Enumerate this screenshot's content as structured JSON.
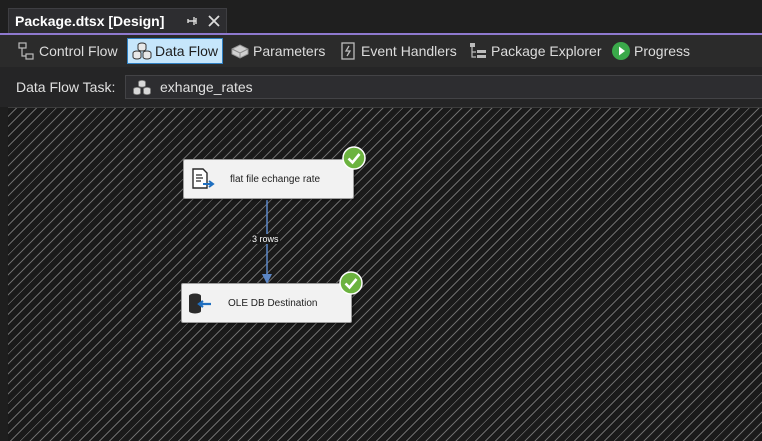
{
  "document_tab": {
    "title": "Package.dtsx [Design]",
    "pin_icon": "pin-icon",
    "close_icon": "close-icon"
  },
  "designer_tabs": [
    {
      "label": "Control Flow",
      "icon": "control-flow-icon",
      "active": false
    },
    {
      "label": "Data Flow",
      "icon": "data-flow-icon",
      "active": true
    },
    {
      "label": "Parameters",
      "icon": "parameters-icon",
      "active": false
    },
    {
      "label": "Event Handlers",
      "icon": "event-handlers-icon",
      "active": false
    },
    {
      "label": "Package Explorer",
      "icon": "package-explorer-icon",
      "active": false
    },
    {
      "label": "Progress",
      "icon": "progress-icon",
      "active": false
    }
  ],
  "task_bar": {
    "label": "Data Flow Task:",
    "selected_task": "exhange_rates",
    "icon": "data-flow-task-icon"
  },
  "canvas": {
    "components": [
      {
        "label": "flat file echange rate",
        "icon": "flat-file-source-icon",
        "status": "success",
        "status_icon": "check-icon"
      },
      {
        "label": "OLE DB Destination",
        "icon": "ole-db-destination-icon",
        "status": "success",
        "status_icon": "check-icon"
      }
    ],
    "path": {
      "label": "3 rows"
    }
  },
  "colors": {
    "accent": "#8e79cf",
    "active_tab_bg": "#c6e6fb",
    "success_green": "#6cb33f",
    "connector_blue": "#5b86c6"
  }
}
